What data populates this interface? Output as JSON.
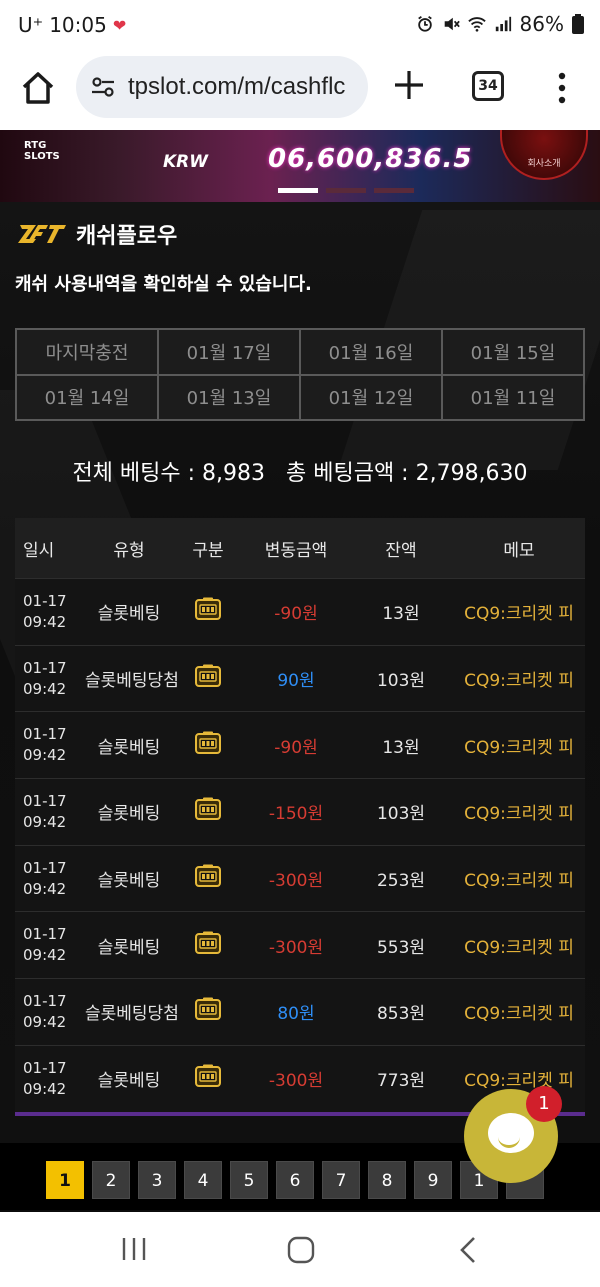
{
  "status_bar": {
    "carrier": "U⁺",
    "time": "10:05",
    "battery": "86%"
  },
  "browser": {
    "url": "tpslot.com/m/cashflc",
    "tab_count": "34"
  },
  "banner": {
    "brand": "RTG SLOTS",
    "currency": "KRW",
    "jackpot": "06,600,836.5",
    "company_label": "회사소개"
  },
  "page": {
    "title": "캐쉬플로우",
    "subtitle": "캐쉬 사용내역을 확인하실 수 있습니다."
  },
  "date_filters": [
    "마지막충전",
    "01월 17일",
    "01월 16일",
    "01월 15일",
    "01월 14일",
    "01월 13일",
    "01월 12일",
    "01월 11일"
  ],
  "totals": {
    "text": "전체 베팅수 : 8,983   총 베팅금액 : 2,798,630"
  },
  "table": {
    "headers": [
      "일시",
      "유형",
      "구분",
      "변동금액",
      "잔액",
      "메모"
    ],
    "rows": [
      {
        "date": "01-17",
        "time": "09:42",
        "type": "슬롯베팅",
        "amount": "-90원",
        "sign": "neg",
        "balance": "13원",
        "memo": "CQ9:크리켓 피"
      },
      {
        "date": "01-17",
        "time": "09:42",
        "type": "슬롯베팅당첨",
        "amount": "90원",
        "sign": "pos",
        "balance": "103원",
        "memo": "CQ9:크리켓 피"
      },
      {
        "date": "01-17",
        "time": "09:42",
        "type": "슬롯베팅",
        "amount": "-90원",
        "sign": "neg",
        "balance": "13원",
        "memo": "CQ9:크리켓 피"
      },
      {
        "date": "01-17",
        "time": "09:42",
        "type": "슬롯베팅",
        "amount": "-150원",
        "sign": "neg",
        "balance": "103원",
        "memo": "CQ9:크리켓 피"
      },
      {
        "date": "01-17",
        "time": "09:42",
        "type": "슬롯베팅",
        "amount": "-300원",
        "sign": "neg",
        "balance": "253원",
        "memo": "CQ9:크리켓 피"
      },
      {
        "date": "01-17",
        "time": "09:42",
        "type": "슬롯베팅",
        "amount": "-300원",
        "sign": "neg",
        "balance": "553원",
        "memo": "CQ9:크리켓 피"
      },
      {
        "date": "01-17",
        "time": "09:42",
        "type": "슬롯베팅당첨",
        "amount": "80원",
        "sign": "pos",
        "balance": "853원",
        "memo": "CQ9:크리켓 피"
      },
      {
        "date": "01-17",
        "time": "09:42",
        "type": "슬롯베팅",
        "amount": "-300원",
        "sign": "neg",
        "balance": "773원",
        "memo": "CQ9:크리켓 피"
      }
    ]
  },
  "pagination": {
    "pages": [
      "1",
      "2",
      "3",
      "4",
      "5",
      "6",
      "7",
      "8",
      "9",
      "1"
    ],
    "active": "1"
  },
  "chat": {
    "badge_count": "1"
  },
  "colors": {
    "negative": "#d63c33",
    "positive": "#2f8ef5",
    "memo": "#e3b13a",
    "active_page": "#f3c000",
    "chat_button": "#c8b638"
  }
}
